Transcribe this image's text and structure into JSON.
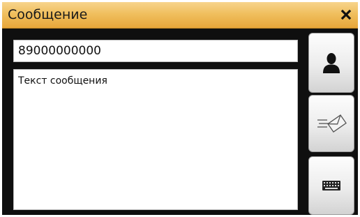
{
  "window": {
    "title": "Сообщение"
  },
  "phone": {
    "value": "89000000000"
  },
  "message": {
    "text": "Текст сообщения"
  },
  "buttons": {
    "contacts_icon": "person-icon",
    "send_icon": "envelope-send-icon",
    "keyboard_icon": "keyboard-icon"
  }
}
